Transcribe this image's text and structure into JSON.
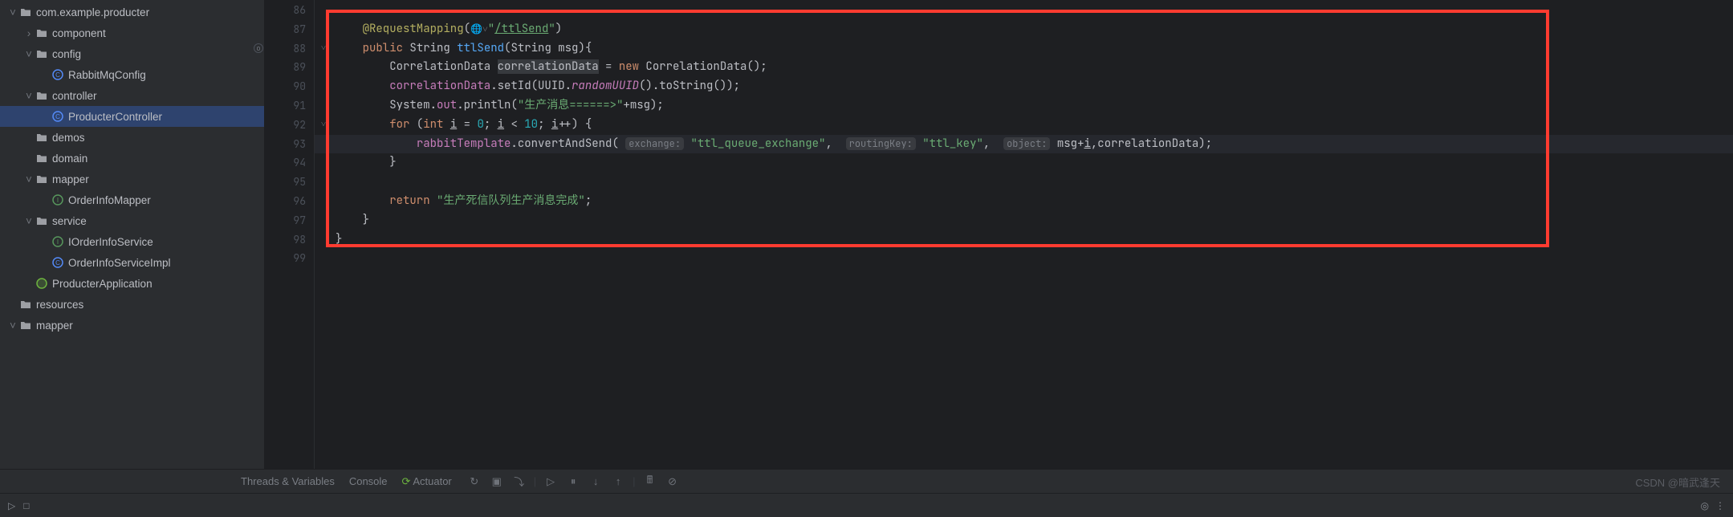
{
  "sidebar": {
    "items": [
      {
        "indent": 0,
        "chev": "down",
        "icon": "package",
        "iconColor": "#ced0d6",
        "label": "com.example.producter"
      },
      {
        "indent": 1,
        "chev": "right",
        "icon": "package",
        "iconColor": "#ced0d6",
        "label": "component"
      },
      {
        "indent": 1,
        "chev": "down",
        "icon": "package",
        "iconColor": "#ced0d6",
        "label": "config"
      },
      {
        "indent": 2,
        "chev": "none",
        "icon": "class",
        "iconColor": "#548af7",
        "label": "RabbitMqConfig"
      },
      {
        "indent": 1,
        "chev": "down",
        "icon": "package",
        "iconColor": "#ced0d6",
        "label": "controller"
      },
      {
        "indent": 2,
        "chev": "none",
        "icon": "class",
        "iconColor": "#548af7",
        "label": "ProducterController",
        "selected": true
      },
      {
        "indent": 1,
        "chev": "none",
        "icon": "package",
        "iconColor": "#ced0d6",
        "label": "demos"
      },
      {
        "indent": 1,
        "chev": "none",
        "icon": "package",
        "iconColor": "#ced0d6",
        "label": "domain"
      },
      {
        "indent": 1,
        "chev": "down",
        "icon": "package",
        "iconColor": "#ced0d6",
        "label": "mapper"
      },
      {
        "indent": 2,
        "chev": "none",
        "icon": "interface",
        "iconColor": "#57965c",
        "label": "OrderInfoMapper"
      },
      {
        "indent": 1,
        "chev": "down",
        "icon": "package",
        "iconColor": "#ced0d6",
        "label": "service"
      },
      {
        "indent": 2,
        "chev": "none",
        "icon": "interface",
        "iconColor": "#57965c",
        "label": "IOrderInfoService"
      },
      {
        "indent": 2,
        "chev": "none",
        "icon": "class",
        "iconColor": "#548af7",
        "label": "OrderInfoServiceImpl"
      },
      {
        "indent": 1,
        "chev": "none",
        "icon": "spring",
        "iconColor": "#6db33f",
        "label": "ProducterApplication"
      },
      {
        "indent": 0,
        "chev": "none",
        "icon": "resources",
        "iconColor": "#ced0d6",
        "label": "resources"
      },
      {
        "indent": 0,
        "chev": "down",
        "icon": "folder",
        "iconColor": "#ced0d6",
        "label": "mapper"
      }
    ]
  },
  "gutter": {
    "start": 86,
    "end": 99,
    "mark_line": 88,
    "fold_lines": [
      88,
      92
    ]
  },
  "code": {
    "indent": "    ",
    "annotation": "@RequestMapping",
    "annotation_path": "/ttlSend",
    "sig_kw": "public",
    "sig_type": "String",
    "sig_name": "ttlSend",
    "sig_params": "(String msg){",
    "l3_a": "CorrelationData ",
    "l3_b": "correlationData",
    "l3_c": " = ",
    "l3_d": "new",
    "l3_e": " CorrelationData();",
    "l4_a": "correlationData",
    "l4_b": ".setId(UUID.",
    "l4_c": "randomUUID",
    "l4_d": "().toString());",
    "l5_a": "System.",
    "l5_b": "out",
    "l5_c": ".println(",
    "l5_str": "\"生产消息======>\"",
    "l5_d": "+msg);",
    "l6_a": "for",
    "l6_b": " (",
    "l6_c": "int",
    "l6_d": " ",
    "l6_u1": "i",
    "l6_e": " = ",
    "l6_n0": "0",
    "l6_f": "; ",
    "l6_u2": "i",
    "l6_g": " < ",
    "l6_n1": "10",
    "l6_h": "; ",
    "l6_u3": "i",
    "l6_i": "++) {",
    "l7_a": "rabbitTemplate",
    "l7_b": ".convertAndSend(",
    "l7_h1": "exchange:",
    "l7_s1": "\"ttl_queue_exchange\"",
    "l7_c": ", ",
    "l7_h2": "routingKey:",
    "l7_s2": "\"ttl_key\"",
    "l7_d": ", ",
    "l7_h3": "object:",
    "l7_e": " msg+",
    "l7_u": "i",
    "l7_f": ",correlationData);",
    "l8": "}",
    "l10_a": "return",
    "l10_s": "\"生产死信队列生产消息完成\"",
    "l10_b": ";",
    "l11": "}",
    "l12": "}"
  },
  "debug": {
    "tab1": "Threads & Variables",
    "tab2": "Console",
    "tab3": "Actuator"
  },
  "watermark": "CSDN @暗武逢天"
}
